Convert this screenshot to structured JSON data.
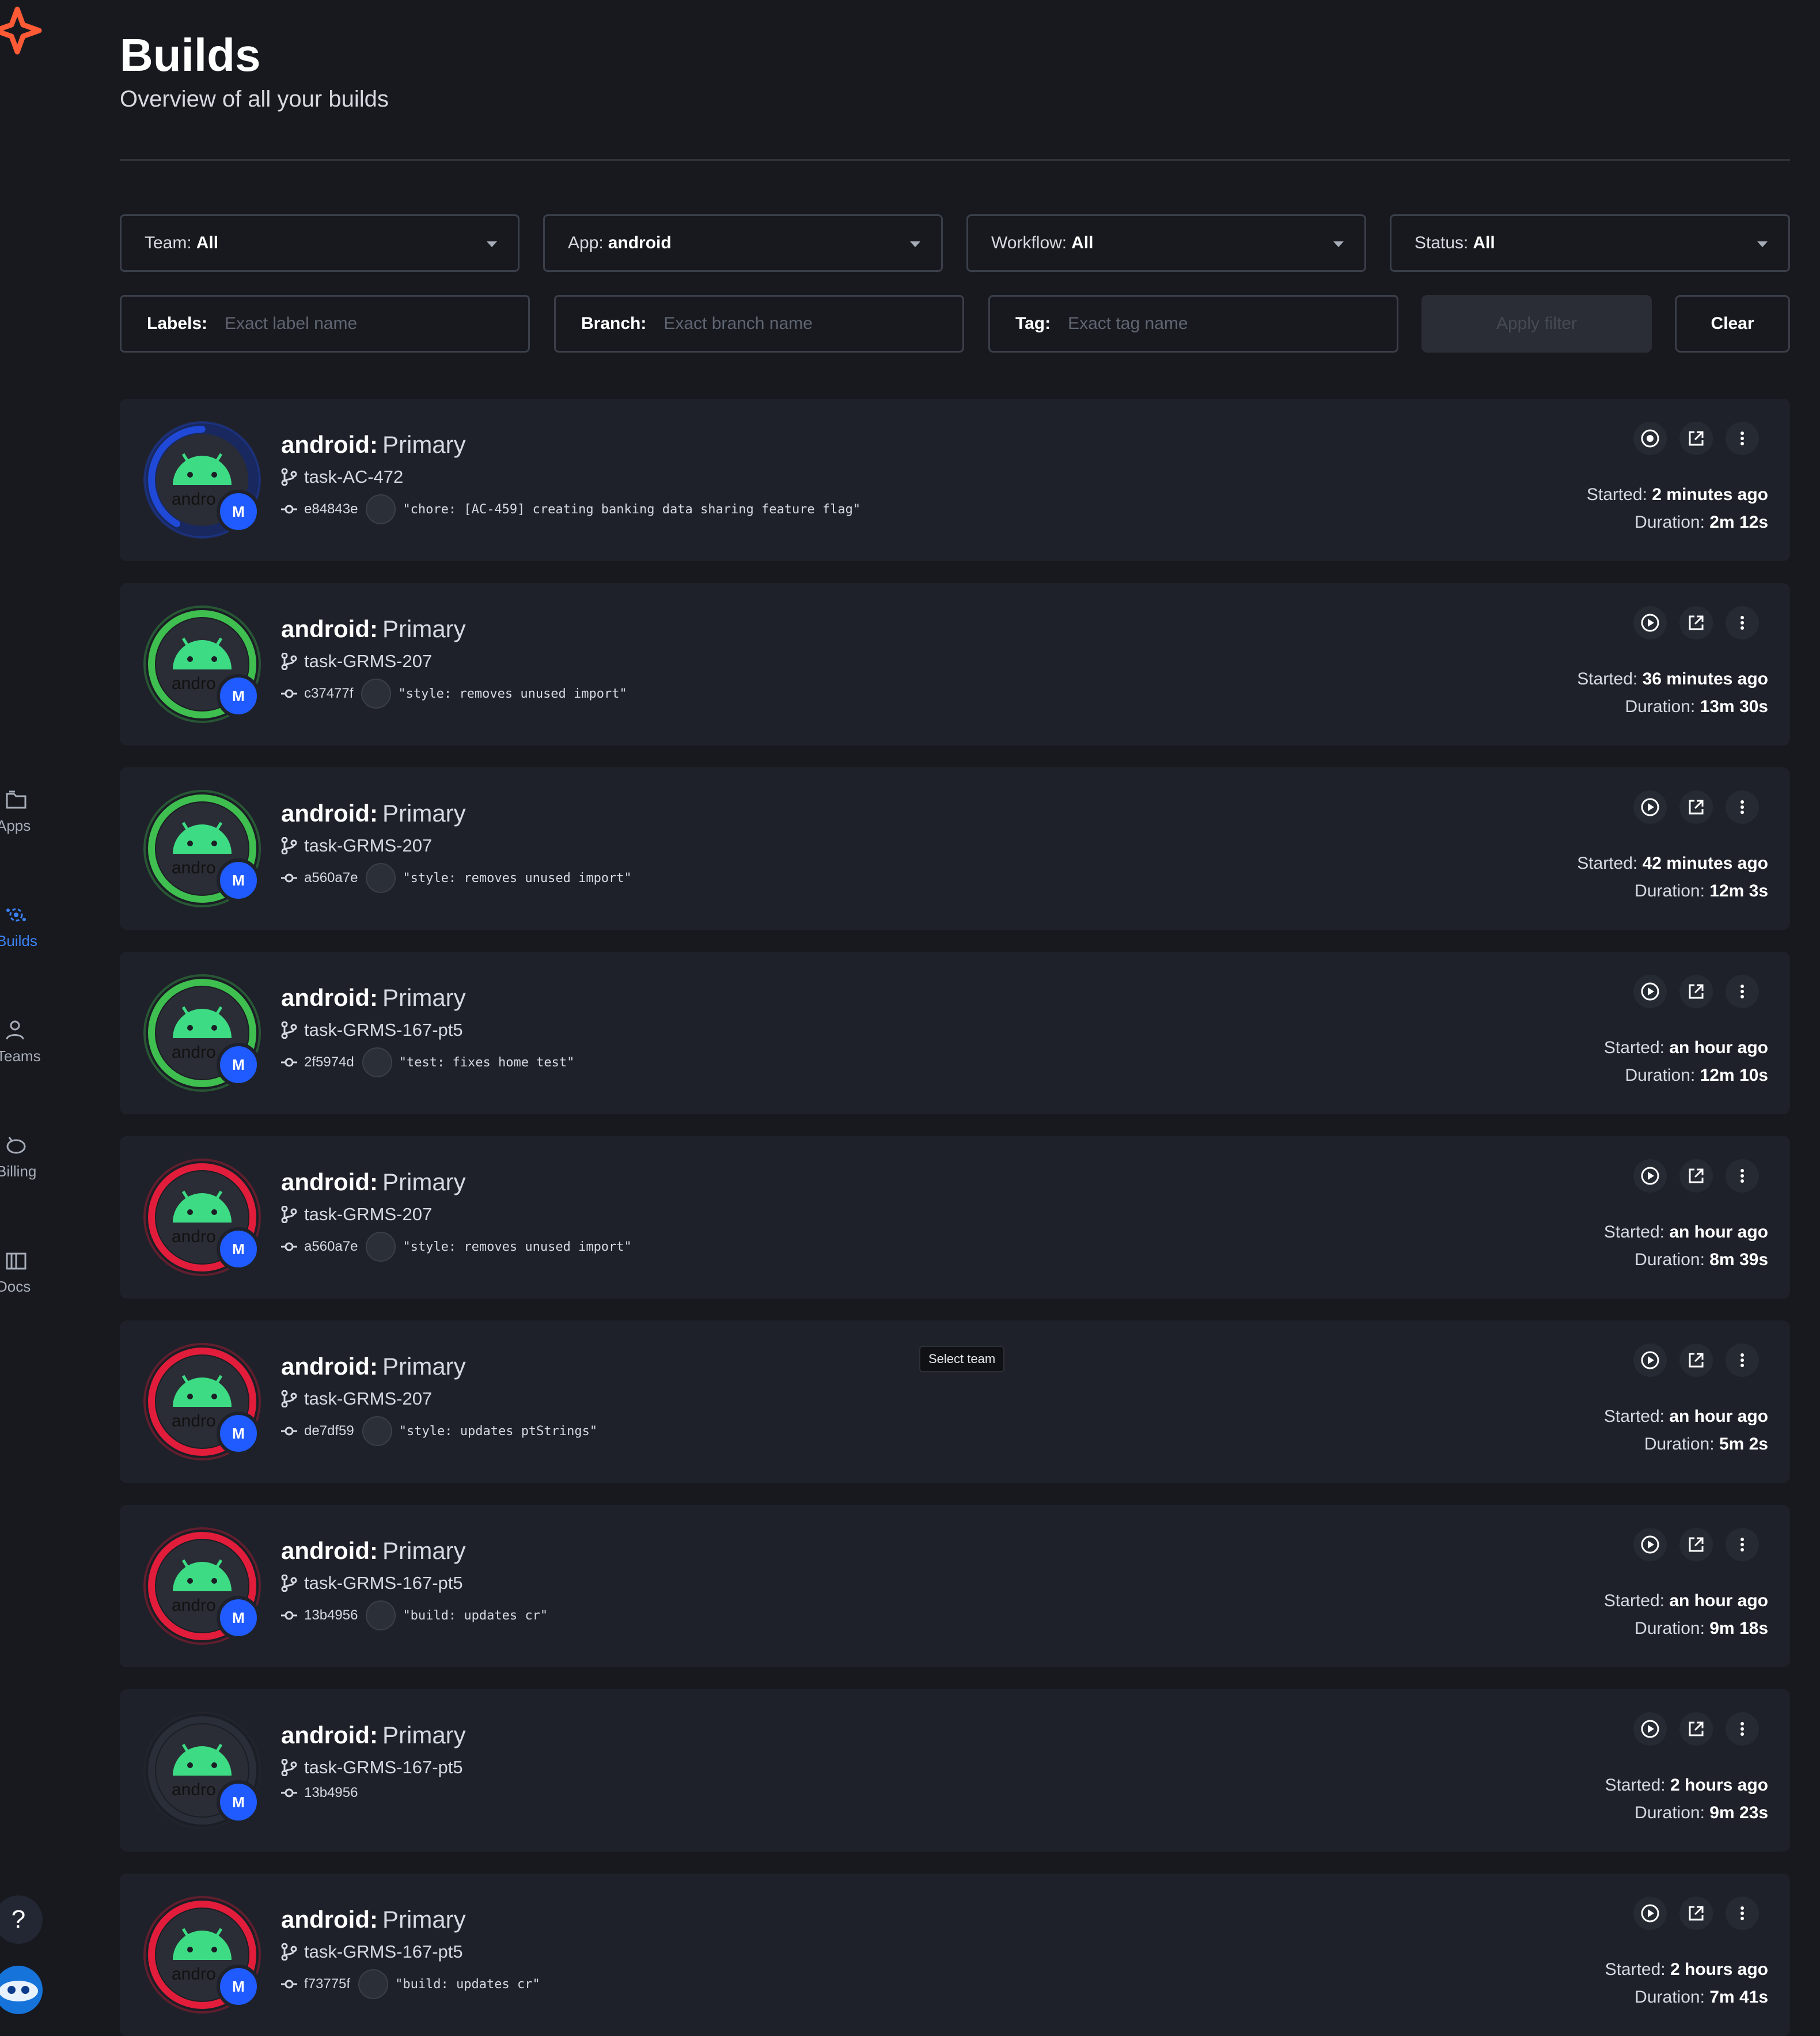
{
  "sidebar": {
    "items": [
      {
        "label": "Apps",
        "icon": "folder-icon"
      },
      {
        "label": "Builds",
        "icon": "builds-icon",
        "active": true
      },
      {
        "label": "Teams",
        "icon": "users-icon"
      },
      {
        "label": "Billing",
        "icon": "piggy-bank-icon"
      },
      {
        "label": "Docs",
        "icon": "book-icon"
      }
    ],
    "help_label": "?"
  },
  "header": {
    "title": "Builds",
    "subtitle": "Overview of all your builds"
  },
  "filters": {
    "team": {
      "label": "Team:",
      "value": "All"
    },
    "app": {
      "label": "App:",
      "value": "android"
    },
    "workflow": {
      "label": "Workflow:",
      "value": "All"
    },
    "status": {
      "label": "Status:",
      "value": "All"
    },
    "labels": {
      "label": "Labels:",
      "placeholder": "Exact label name"
    },
    "branch": {
      "label": "Branch:",
      "placeholder": "Exact branch name"
    },
    "tag": {
      "label": "Tag:",
      "placeholder": "Exact tag name"
    },
    "apply_label": "Apply filter",
    "clear_label": "Clear"
  },
  "tooltip": "Select team",
  "colors": {
    "accent": "#1f5bff",
    "running": "#1f49d6",
    "success": "#3fbf4f",
    "failed": "#e21d3b",
    "canceled": "#2a2e38"
  },
  "builds": [
    {
      "app": "android:",
      "workflow": "Primary",
      "branch": "task-AC-472",
      "hash": "e84843e",
      "message": "\"chore: [AC-459] creating banking data sharing feature flag\"",
      "started_label": "Started:",
      "started": "2 minutes ago",
      "duration_label": "Duration:",
      "duration": "2m 12s",
      "status": "running",
      "action_icon": "stop-icon",
      "user_initial": "M"
    },
    {
      "app": "android:",
      "workflow": "Primary",
      "branch": "task-GRMS-207",
      "hash": "c37477f",
      "message": "\"style: removes unused import\"",
      "started_label": "Started:",
      "started": "36 minutes ago",
      "duration_label": "Duration:",
      "duration": "13m 30s",
      "status": "success",
      "action_icon": "play-icon",
      "user_initial": "M"
    },
    {
      "app": "android:",
      "workflow": "Primary",
      "branch": "task-GRMS-207",
      "hash": "a560a7e",
      "message": "\"style: removes unused import\"",
      "started_label": "Started:",
      "started": "42 minutes ago",
      "duration_label": "Duration:",
      "duration": "12m 3s",
      "status": "success",
      "action_icon": "play-icon",
      "user_initial": "M"
    },
    {
      "app": "android:",
      "workflow": "Primary",
      "branch": "task-GRMS-167-pt5",
      "hash": "2f5974d",
      "message": "\"test: fixes home test\"",
      "started_label": "Started:",
      "started": "an hour ago",
      "duration_label": "Duration:",
      "duration": "12m 10s",
      "status": "success",
      "action_icon": "play-icon",
      "user_initial": "M"
    },
    {
      "app": "android:",
      "workflow": "Primary",
      "branch": "task-GRMS-207",
      "hash": "a560a7e",
      "message": "\"style: removes unused import\"",
      "started_label": "Started:",
      "started": "an hour ago",
      "duration_label": "Duration:",
      "duration": "8m 39s",
      "status": "failed",
      "action_icon": "play-icon",
      "user_initial": "M"
    },
    {
      "app": "android:",
      "workflow": "Primary",
      "branch": "task-GRMS-207",
      "hash": "de7df59",
      "message": "\"style: updates ptStrings\"",
      "started_label": "Started:",
      "started": "an hour ago",
      "duration_label": "Duration:",
      "duration": "5m 2s",
      "status": "failed",
      "action_icon": "play-icon",
      "user_initial": "M"
    },
    {
      "app": "android:",
      "workflow": "Primary",
      "branch": "task-GRMS-167-pt5",
      "hash": "13b4956",
      "message": "\"build: updates cr\"",
      "started_label": "Started:",
      "started": "an hour ago",
      "duration_label": "Duration:",
      "duration": "9m 18s",
      "status": "failed",
      "action_icon": "play-icon",
      "user_initial": "M"
    },
    {
      "app": "android:",
      "workflow": "Primary",
      "branch": "task-GRMS-167-pt5",
      "hash": "13b4956",
      "message": "",
      "started_label": "Started:",
      "started": "2 hours ago",
      "duration_label": "Duration:",
      "duration": "9m 23s",
      "status": "canceled",
      "action_icon": "play-icon",
      "user_initial": "M"
    },
    {
      "app": "android:",
      "workflow": "Primary",
      "branch": "task-GRMS-167-pt5",
      "hash": "f73775f",
      "message": "\"build: updates cr\"",
      "started_label": "Started:",
      "started": "2 hours ago",
      "duration_label": "Duration:",
      "duration": "7m 41s",
      "status": "failed",
      "action_icon": "play-icon",
      "user_initial": "M"
    }
  ]
}
